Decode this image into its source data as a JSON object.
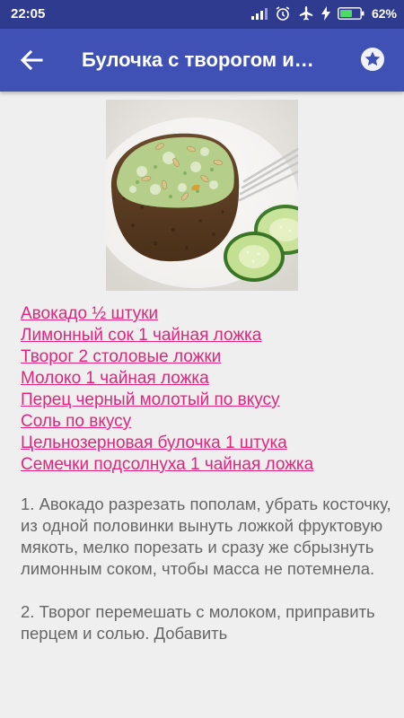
{
  "status_bar": {
    "time": "22:05",
    "battery_percent": "62%",
    "battery_level": 0.62,
    "icons": [
      "signal-icon",
      "alarm-icon",
      "airplane-mode-icon",
      "charging-icon",
      "battery-icon"
    ]
  },
  "app_bar": {
    "title": "Булочка с творогом и…",
    "back_icon": "arrow-back-icon",
    "favorite_icon": "star-icon",
    "color": "#3f51b5"
  },
  "recipe": {
    "ingredients": [
      "Авокадо ½ штуки",
      "Лимонный сок 1 чайная ложка",
      "Творог 2 столовые ложки",
      "Молоко 1 чайная ложка",
      "Перец черный молотый по вкусу",
      "Соль по вкусу",
      "Цельнозерновая булочка 1 штука",
      "Семечки подсолнуха 1 чайная ложка"
    ],
    "steps": [
      "1. Авокадо разрезать пополам, убрать косточку, из одной половинки вынуть ложкой фруктовую мякоть, мелко порезать и сразу же сбрызнуть лимонным соком, чтобы масса не потемнела.",
      "2. Творог перемешать с молоком, приправить перцем и солью. Добавить"
    ]
  },
  "colors": {
    "link": "#e4247c",
    "status_bar": "#2f3b8f",
    "background": "#efefef"
  }
}
